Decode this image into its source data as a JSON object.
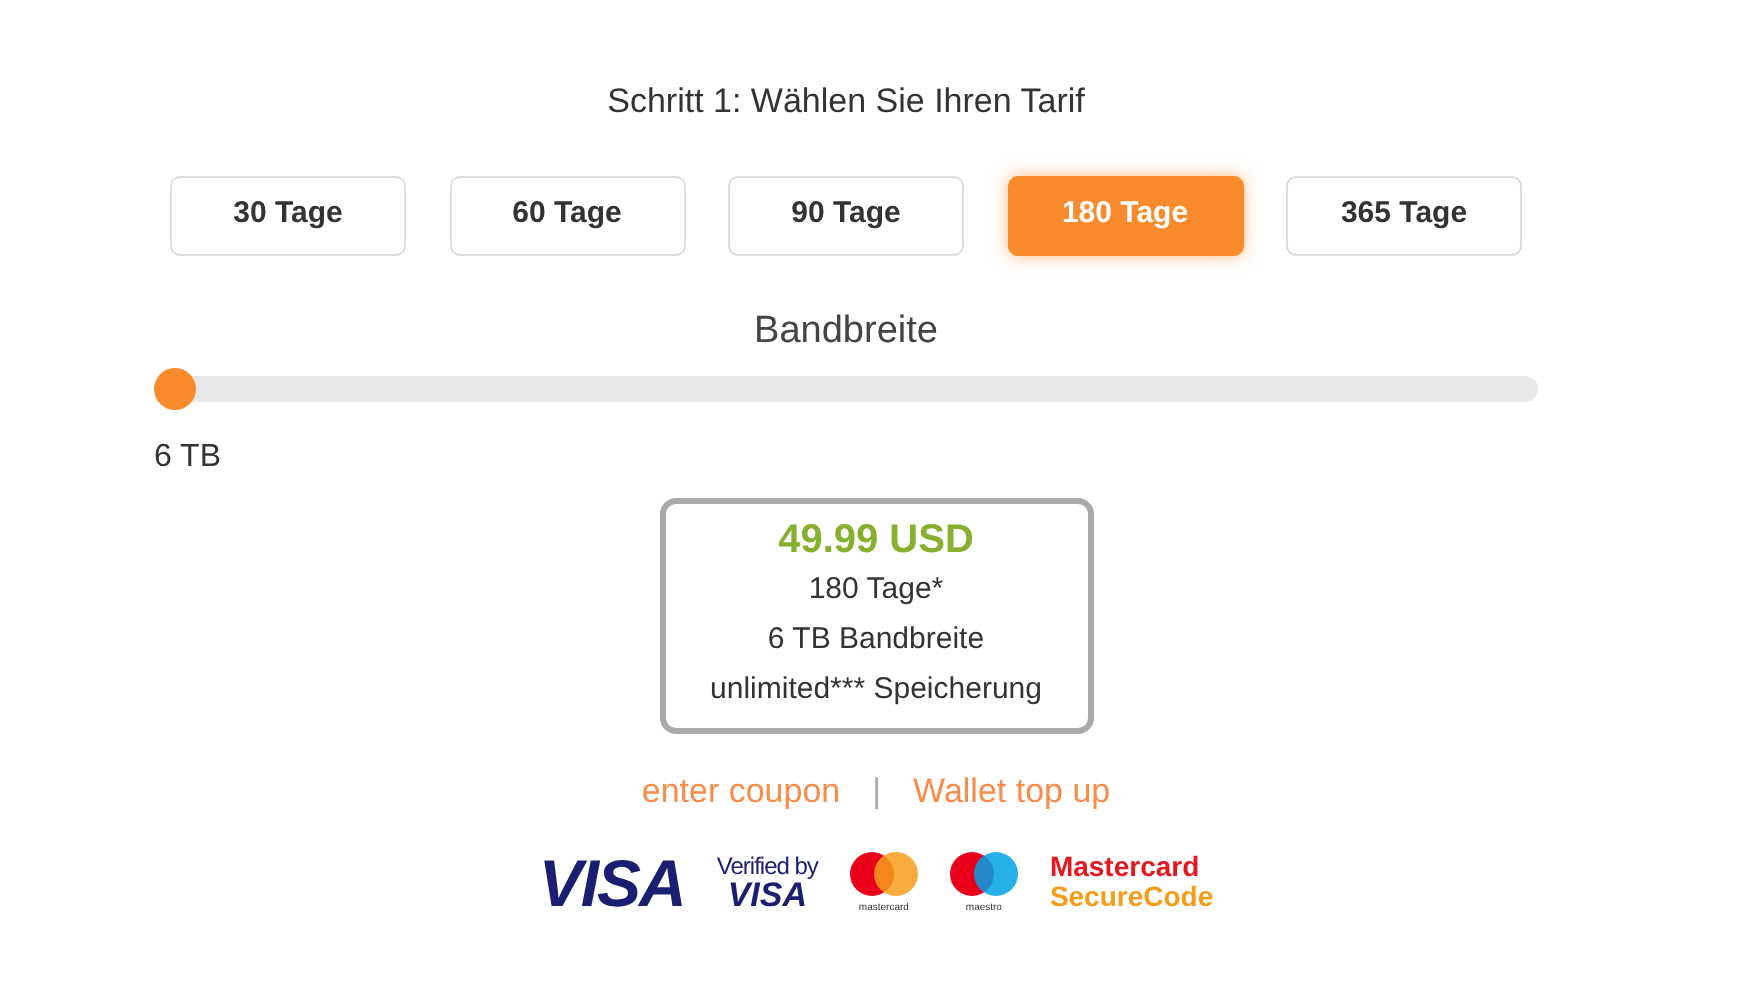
{
  "step_title": "Schritt 1: Wählen Sie Ihren Tarif",
  "plans": [
    {
      "label": "30 Tage",
      "selected": false
    },
    {
      "label": "60 Tage",
      "selected": false
    },
    {
      "label": "90 Tage",
      "selected": false
    },
    {
      "label": "180 Tage",
      "selected": true
    },
    {
      "label": "365 Tage",
      "selected": false
    }
  ],
  "bandwidth": {
    "label": "Bandbreite",
    "level": 0,
    "reading": "6 TB"
  },
  "summary": {
    "price": "49.99 USD",
    "lines": [
      "180 Tage*",
      "6 TB Bandbreite",
      "unlimited*** Speicherung"
    ]
  },
  "links": [
    {
      "label": "enter coupon"
    },
    {
      "label": "Wallet top up"
    }
  ],
  "separator": "|",
  "payment_logos": [
    {
      "kind": "visa",
      "text": "VISA"
    },
    {
      "kind": "verified",
      "top": "Verified by",
      "bottom": "VISA"
    },
    {
      "kind": "mastercard",
      "text": "mastercard"
    },
    {
      "kind": "maestro",
      "text": "maestro"
    },
    {
      "kind": "securecode",
      "top": "Mastercard",
      "bottom": "SecureCode"
    }
  ]
}
